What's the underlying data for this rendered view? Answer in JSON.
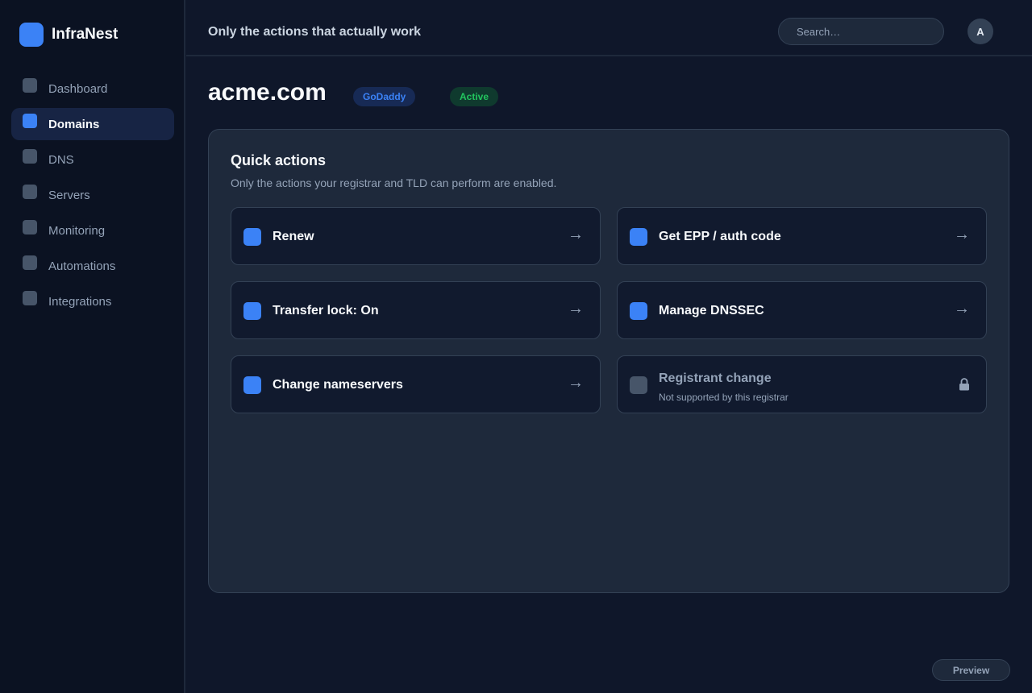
{
  "app": {
    "name": "InfraNest"
  },
  "sidebar": {
    "items": [
      {
        "label": "Dashboard",
        "active": false
      },
      {
        "label": "Domains",
        "active": true
      },
      {
        "label": "DNS",
        "active": false
      },
      {
        "label": "Servers",
        "active": false
      },
      {
        "label": "Monitoring",
        "active": false
      },
      {
        "label": "Automations",
        "active": false
      },
      {
        "label": "Integrations",
        "active": false
      }
    ]
  },
  "header": {
    "title": "Only the actions that actually work",
    "search_placeholder": "Search…",
    "avatar_initial": "A"
  },
  "domain": {
    "name": "acme.com",
    "registrar": "GoDaddy",
    "status": "Active"
  },
  "quick_actions": {
    "title": "Quick actions",
    "subtitle": "Only the actions your registrar and TLD can perform are enabled.",
    "items": [
      {
        "label": "Renew",
        "enabled": true,
        "arrow": "→"
      },
      {
        "label": "Get EPP / auth code",
        "enabled": true,
        "arrow": "→"
      },
      {
        "label": "Transfer lock: On",
        "enabled": true,
        "arrow": "→"
      },
      {
        "label": "Manage DNSSEC",
        "enabled": true,
        "arrow": "→"
      },
      {
        "label": "Change nameservers",
        "enabled": true,
        "arrow": "→"
      },
      {
        "label": "Registrant change",
        "enabled": false,
        "note": "Not supported by this registrar",
        "icon": "lock-icon"
      }
    ]
  },
  "footer": {
    "preview_label": "Preview"
  },
  "colors": {
    "accent": "#3b82f6",
    "success": "#22c55e",
    "background": "#0f172a",
    "panel": "#1e293b"
  }
}
